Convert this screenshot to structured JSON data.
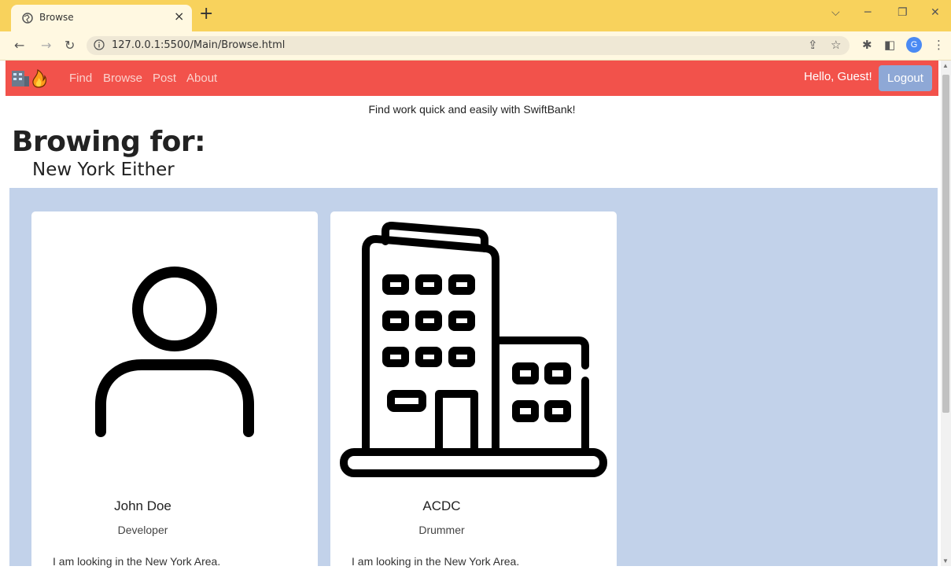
{
  "browser": {
    "tab_title": "Browse",
    "tab_close": "×",
    "new_tab": "+",
    "url": "127.0.0.1:5500/Main/Browse.html",
    "profile_initial": "G",
    "icons": [
      "back-icon",
      "forward-icon",
      "reload-icon",
      "info-icon",
      "share-icon",
      "star-icon",
      "extensions-icon",
      "side-panel-icon",
      "menu-icon"
    ]
  },
  "navbar": {
    "links": [
      "Find",
      "Browse",
      "Post",
      "About"
    ],
    "greeting": "Hello, Guest!",
    "logout_label": "Logout",
    "brand_icons": [
      "building-emoji",
      "fire-emoji"
    ]
  },
  "tagline": "Find work quick and easily with SwiftBank!",
  "heading": {
    "title": "Browing for:",
    "location": "New York Either"
  },
  "cards": [
    {
      "name": "John Doe",
      "role": "Developer",
      "description": "I am looking in the New York Area.",
      "icon": "person-icon"
    },
    {
      "name": "ACDC",
      "role": "Drummer",
      "description": "I am looking in the New York Area.",
      "icon": "building-icon"
    }
  ],
  "colors": {
    "tabstrip": "#f8d25c",
    "navbar": "#f2524b",
    "logout": "#8ea8d6",
    "results_bg": "#c2d2ea"
  }
}
